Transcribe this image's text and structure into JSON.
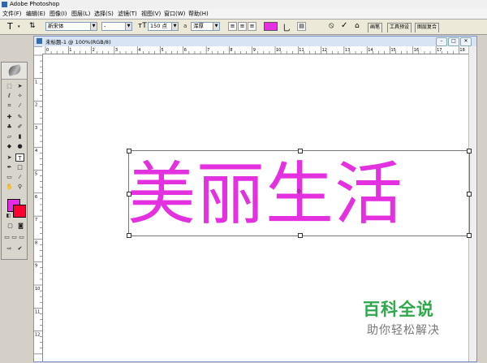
{
  "app": {
    "title": "Adobe Photoshop"
  },
  "menu": [
    "文件(F)",
    "编辑(E)",
    "图像(I)",
    "图层(L)",
    "选择(S)",
    "滤镜(T)",
    "视图(V)",
    "窗口(W)",
    "帮助(H)"
  ],
  "options": {
    "tool_glyph": "T",
    "font_family": "新宋体",
    "font_style": "-",
    "font_size": "150 点",
    "antialias_label": "a",
    "antialias": "浑厚",
    "text_color": "#e331df",
    "confirm": "✓",
    "cancel": "⦸",
    "palette_tabs": [
      "画笔",
      "工具预设",
      "图层复合"
    ]
  },
  "document": {
    "title": "未标题-1 @ 100%(RGB/8)",
    "text": "美丽生活",
    "h_ruler_labels": [
      "0",
      "1",
      "2",
      "3",
      "4",
      "5",
      "6",
      "7",
      "8",
      "9",
      "10",
      "11",
      "12",
      "13",
      "14",
      "15",
      "16",
      "17",
      "18"
    ],
    "v_ruler_labels": [
      "1",
      "2",
      "3",
      "4",
      "5",
      "6",
      "7",
      "8",
      "9",
      "10",
      "11",
      "12"
    ]
  },
  "colors": {
    "foreground": "#e62ae6",
    "background": "#ff0033"
  },
  "watermark": {
    "title": "百科全说",
    "subtitle": "助你轻松解决"
  }
}
